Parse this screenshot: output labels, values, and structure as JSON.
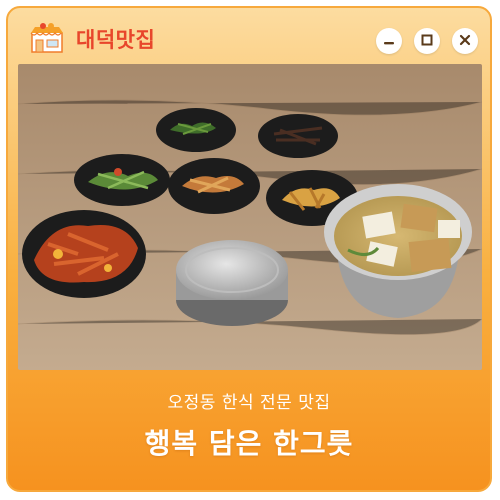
{
  "window": {
    "app_title": "대덕맛집",
    "logo_icon": "restaurant-storefront-icon",
    "controls": {
      "minimize_icon": "minimize-icon",
      "maximize_icon": "maximize-icon",
      "close_icon": "close-icon"
    }
  },
  "photo": {
    "description_icon": "korean-meal-photo"
  },
  "caption": {
    "subtitle": "오정동 한식 전문 맛집",
    "headline": "행복 담은 한그릇"
  },
  "colors": {
    "accent": "#f6921f",
    "title_red": "#e8462b",
    "frame_light": "#fcdca0"
  }
}
